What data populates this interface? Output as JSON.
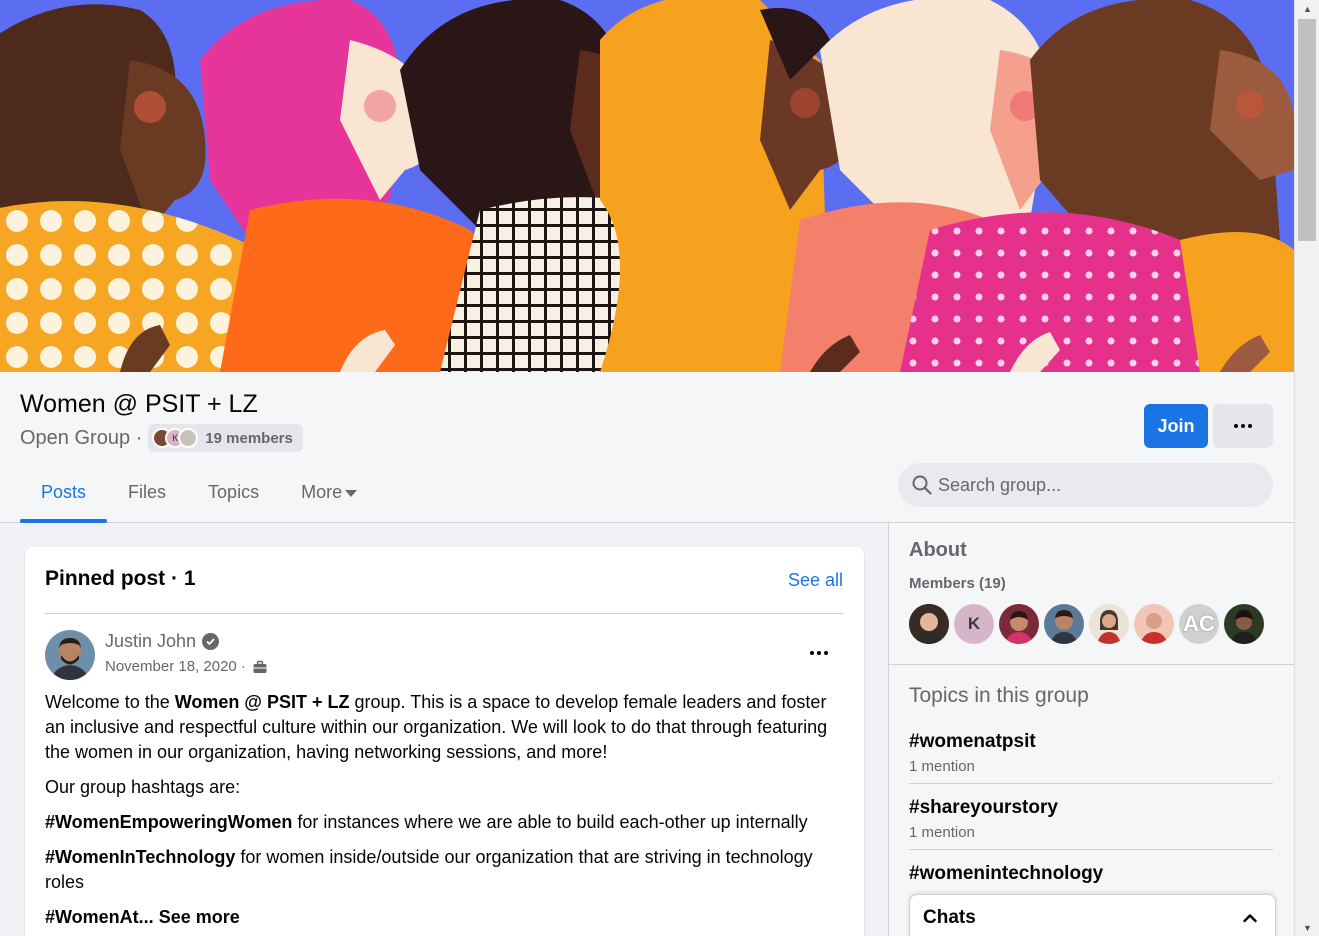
{
  "group": {
    "title": "Women @ PSIT + LZ",
    "privacy": "Open Group ·",
    "members_count": "19 members",
    "mini_avatar_initial": "K"
  },
  "actions": {
    "join_label": "Join",
    "more_icon": "ellipsis-icon"
  },
  "tabs": [
    {
      "label": "Posts",
      "active": true
    },
    {
      "label": "Files",
      "active": false
    },
    {
      "label": "Topics",
      "active": false
    },
    {
      "label": "More",
      "active": false
    }
  ],
  "search": {
    "placeholder": "Search group..."
  },
  "pinned": {
    "heading": "Pinned post · 1",
    "see_all": "See all",
    "author": "Justin John",
    "date": "November 18, 2020 ·",
    "body": {
      "p1_a": "Welcome to the ",
      "p1_b": "Women @ PSIT + LZ",
      "p1_c": " group. This is a space to develop female leaders and foster an inclusive and respectful culture within our organization. We will look to do that through featuring the women in our organization, having networking sessions, and more!",
      "p2": "Our group hashtags are:",
      "p3_tag": "#WomenEmpoweringWomen",
      "p3_text": " for instances where we are able to build each-other up internally",
      "p4_tag": "#WomenInTechnology",
      "p4_text": " for women inside/outside our organization that are striving in technology roles",
      "p5_tag": "#WomenAt...",
      "p5_more": " See more"
    }
  },
  "about": {
    "heading": "About",
    "members_label": "Members (19)",
    "avatar_initials": [
      "K",
      "AC"
    ],
    "topics_heading": "Topics in this group",
    "topics": [
      {
        "name": "#womenatpsit",
        "count": "1 mention"
      },
      {
        "name": "#shareyourstory",
        "count": "1 mention"
      },
      {
        "name": "#womenintechnology",
        "count": ""
      }
    ]
  },
  "chats": {
    "label": "Chats"
  },
  "colors": {
    "accent": "#1b74e4",
    "cover_bg": "#5b6df0"
  }
}
